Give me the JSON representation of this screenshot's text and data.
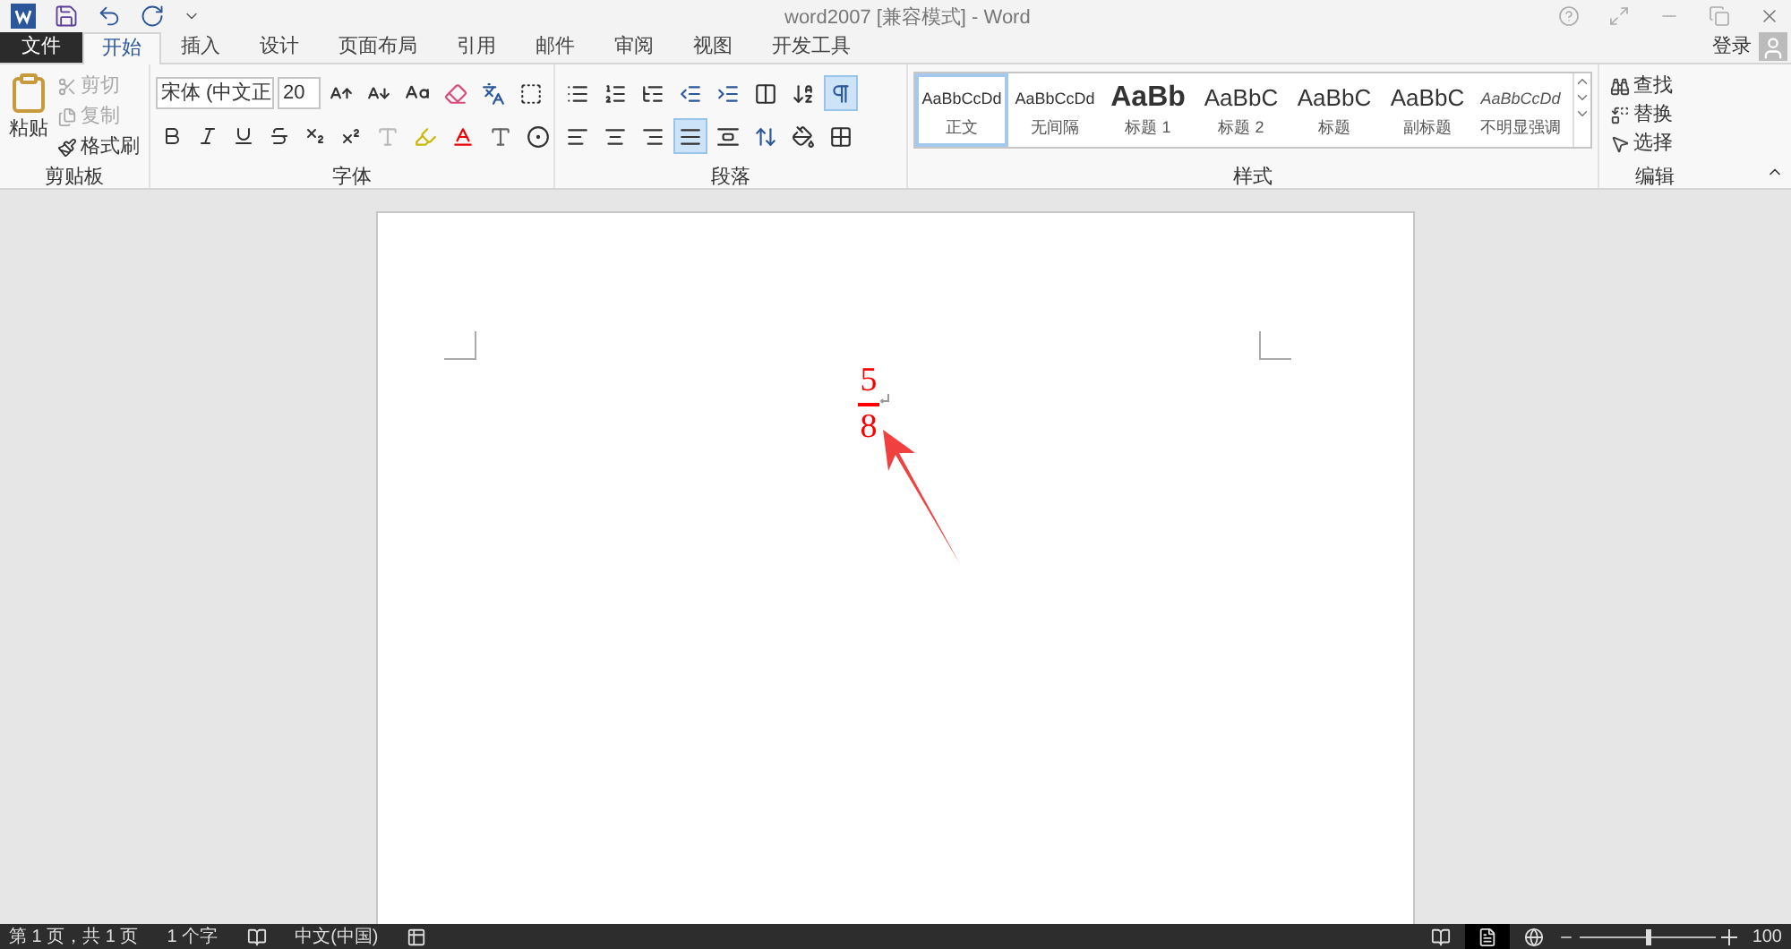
{
  "window": {
    "title": "word2007 [兼容模式] - Word"
  },
  "tabs": [
    {
      "label": "文件",
      "kind": "file",
      "selected": false
    },
    {
      "label": "开始",
      "kind": "tab",
      "selected": true
    },
    {
      "label": "插入",
      "kind": "tab",
      "selected": false
    },
    {
      "label": "设计",
      "kind": "tab",
      "selected": false
    },
    {
      "label": "页面布局",
      "kind": "tab",
      "selected": false
    },
    {
      "label": "引用",
      "kind": "tab",
      "selected": false
    },
    {
      "label": "邮件",
      "kind": "tab",
      "selected": false
    },
    {
      "label": "审阅",
      "kind": "tab",
      "selected": false
    },
    {
      "label": "视图",
      "kind": "tab",
      "selected": false
    },
    {
      "label": "开发工具",
      "kind": "tab",
      "selected": false
    }
  ],
  "account": {
    "label": "登录"
  },
  "clipboard": {
    "group": "剪贴板",
    "paste": "粘贴",
    "items": [
      {
        "label": "剪切",
        "disabled": true
      },
      {
        "label": "复制",
        "disabled": true
      },
      {
        "label": "格式刷",
        "disabled": false
      }
    ]
  },
  "font": {
    "group": "字体",
    "name": "宋体 (中文正",
    "size": "20"
  },
  "paragraph": {
    "group": "段落",
    "alignment": [
      {
        "selected": false
      },
      {
        "selected": false
      },
      {
        "selected": false
      },
      {
        "selected": true
      },
      {
        "selected": false
      }
    ],
    "show_marks": true
  },
  "styles": {
    "group": "样式",
    "items": [
      {
        "preview": "AaBbCcDd",
        "label": "正文",
        "kind": "body",
        "selected": true
      },
      {
        "preview": "AaBbCcDd",
        "label": "无间隔",
        "kind": "nospacing",
        "selected": false
      },
      {
        "preview": "AaBb",
        "label": "标题 1",
        "kind": "h1",
        "selected": false
      },
      {
        "preview": "AaBbC",
        "label": "标题 2",
        "kind": "h2",
        "selected": false
      },
      {
        "preview": "AaBbC",
        "label": "标题",
        "kind": "title",
        "selected": false
      },
      {
        "preview": "AaBbC",
        "label": "副标题",
        "kind": "subtitle",
        "selected": false
      },
      {
        "preview": "AaBbCcDd",
        "label": "不明显强调",
        "kind": "emphasis",
        "selected": false
      }
    ]
  },
  "editing": {
    "group": "编辑",
    "items": [
      {
        "label": "查找",
        "kind": "find"
      },
      {
        "label": "替换",
        "kind": "replace"
      },
      {
        "label": "选择",
        "kind": "select"
      }
    ]
  },
  "document": {
    "fraction": {
      "numerator": "5",
      "denominator": "8",
      "color": "#ff0000"
    }
  },
  "status_bar": {
    "page": "第 1 页，共 1 页",
    "words": "1 个字",
    "language": "中文(中国)",
    "zoom": "100",
    "zoom_slider": {
      "level": 0.5
    }
  }
}
